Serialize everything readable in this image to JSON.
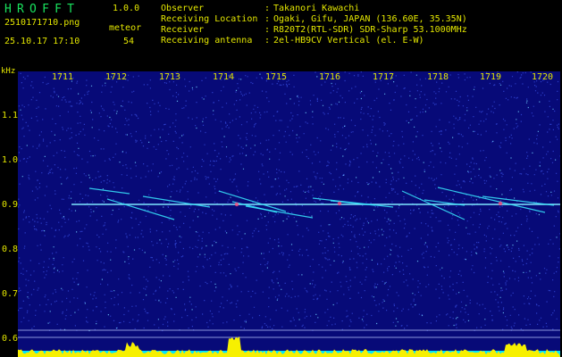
{
  "header": {
    "app_title": "HROFFT",
    "version": "1.0.0",
    "file_name": "2510171710.png",
    "meteor_label": "meteor",
    "timestamp": "25.10.17 17:10",
    "meteor_count": "54"
  },
  "info": [
    {
      "label": "Observer",
      "value": "Takanori Kawachi"
    },
    {
      "label": "Receiving Location",
      "value": "Ogaki, Gifu, JAPAN (136.60E, 35.35N)"
    },
    {
      "label": "Receiver",
      "value": "R820T2(RTL-SDR) SDR-Sharp 53.1000MHz"
    },
    {
      "label": "Receiving antenna",
      "value": "2el-HB9CV Vertical (el. E-W)"
    }
  ],
  "axis": {
    "unit": "kHz",
    "x_ticks": [
      "1711",
      "1712",
      "1713",
      "1714",
      "1715",
      "1716",
      "1717",
      "1718",
      "1719",
      "1720"
    ],
    "y_ticks": [
      "1.1",
      "1.0",
      "0.9",
      "0.8",
      "0.7",
      "0.6"
    ]
  },
  "colors": {
    "background": "#070a78",
    "text": "#e3e600",
    "title": "#19e35e",
    "carrier": "#7fe8ff",
    "histogram": "#f7f000",
    "baseline": "#00e5ff"
  }
}
